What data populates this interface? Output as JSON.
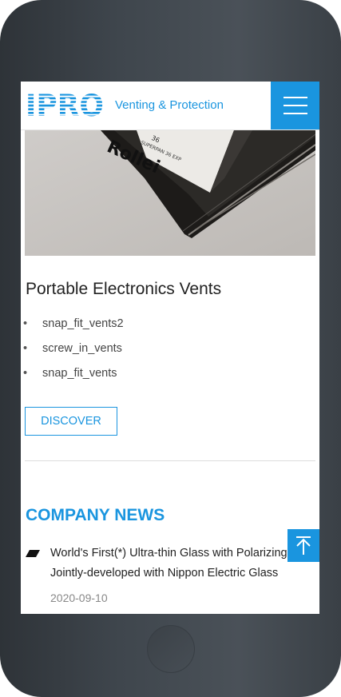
{
  "header": {
    "logo_text": "IPRO",
    "tagline": "Venting & Protection"
  },
  "hero": {
    "film_number": "36",
    "film_text": "SUPERPAN 36 EXP",
    "film_brand": "Rollei"
  },
  "product": {
    "title": "Portable Electronics Vents",
    "items": [
      {
        "label": "snap_fit_vents2"
      },
      {
        "label": "screw_in_vents"
      },
      {
        "label": "snap_fit_vents"
      }
    ],
    "discover_label": "DISCOVER"
  },
  "news": {
    "heading": "COMPANY NEWS",
    "items": [
      {
        "title": "World's First(*) Ultra-thin Glass with Polarizing Film Jointly-developed with Nippon Electric Glass",
        "date": "2020-09-10"
      }
    ]
  },
  "icons": {
    "menu": "hamburger-menu-icon",
    "back_to_top": "arrow-up-icon",
    "news_bullet": "parallelogram-icon"
  },
  "colors": {
    "brand_blue": "#1a95df",
    "text_dark": "#222222",
    "date_gray": "#888888",
    "phone_body": "#3f464d"
  }
}
